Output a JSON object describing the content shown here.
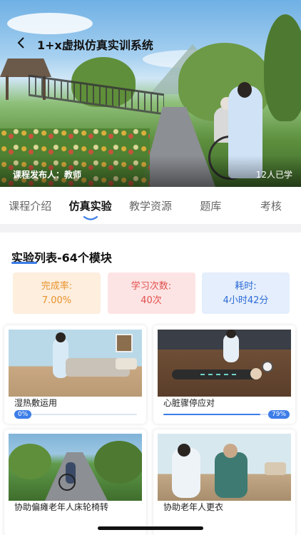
{
  "header": {
    "title": "1+x虚拟仿真实训系统",
    "publisher": "课程发布人：教师",
    "learners": "12人已学"
  },
  "tabs": [
    {
      "label": "课程介绍",
      "active": false
    },
    {
      "label": "仿真实验",
      "active": true
    },
    {
      "label": "教学资源",
      "active": false
    },
    {
      "label": "题库",
      "active": false
    },
    {
      "label": "考核",
      "active": false
    }
  ],
  "section": {
    "title": "实验列表-64个模块"
  },
  "stats": [
    {
      "label": "完成率:",
      "value": "7.00%",
      "color": "#e8922a"
    },
    {
      "label": "学习次数:",
      "value": "40次",
      "color": "#e0504c"
    },
    {
      "label": "耗时:",
      "value": "4小时42分",
      "color": "#2d6bd6"
    }
  ],
  "modules": [
    {
      "name": "湿热敷运用",
      "progress_label": "0%",
      "progress": 0
    },
    {
      "name": "心脏骤停应对",
      "progress_label": "79%",
      "progress": 79
    },
    {
      "name": "协助偏瘫老年人床轮椅转",
      "progress_label": "",
      "progress": null
    },
    {
      "name": "协助老年人更衣",
      "progress_label": "",
      "progress": null
    }
  ],
  "colors": {
    "accent": "#3c7de8",
    "page_bg": "#f2f2f4"
  }
}
